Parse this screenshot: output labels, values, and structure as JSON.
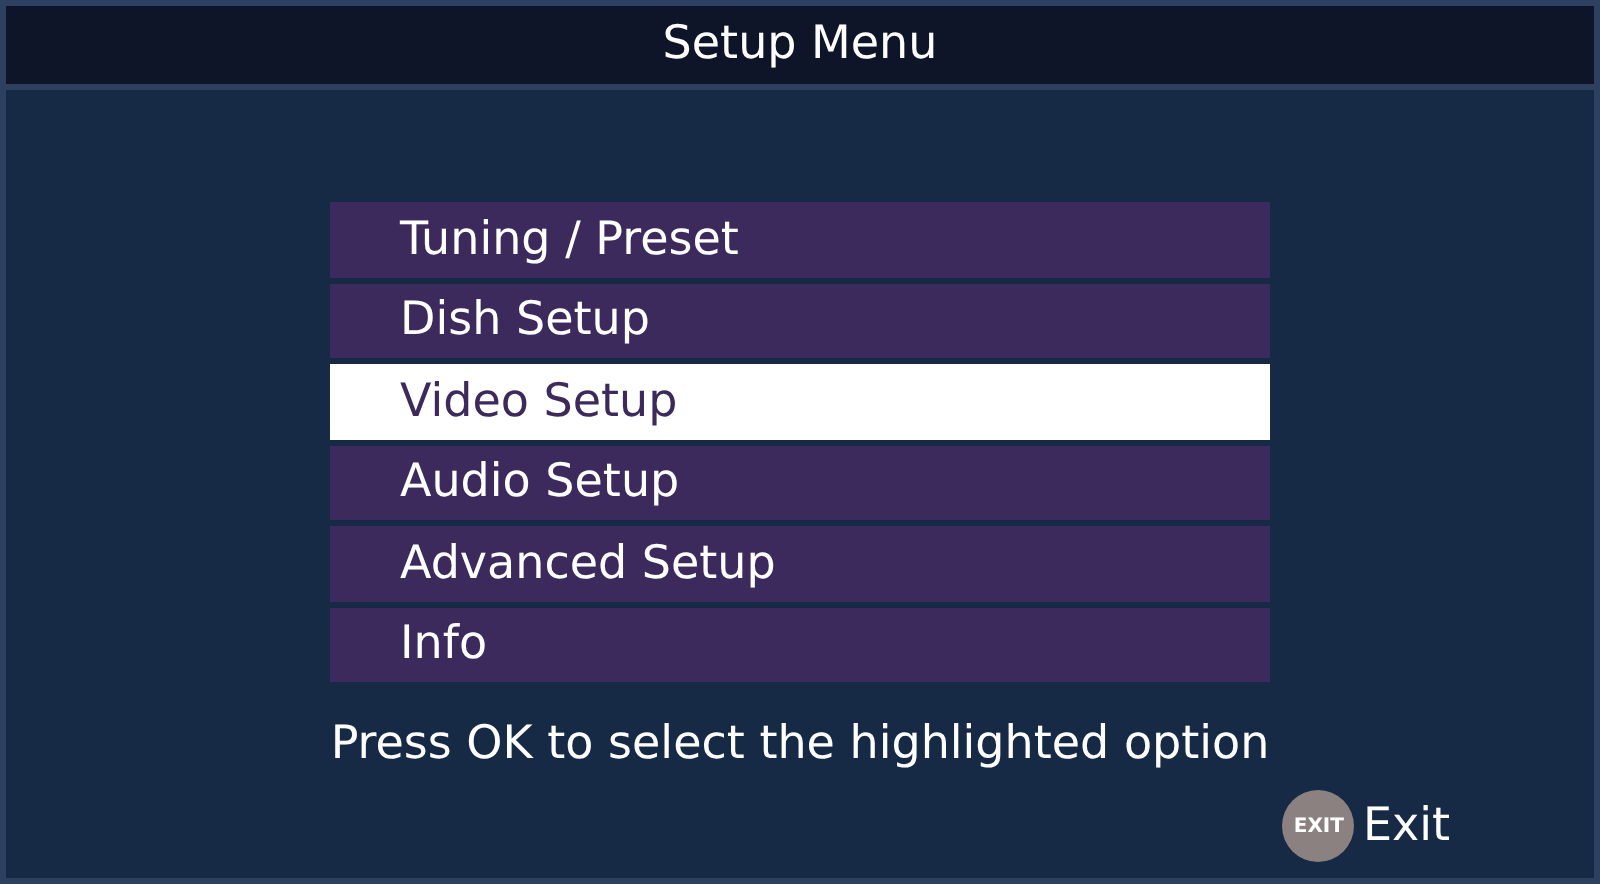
{
  "window": {
    "title": "Setup Menu"
  },
  "menu": [
    {
      "label": "Tuning / Preset",
      "selected": false
    },
    {
      "label": "Dish Setup",
      "selected": false
    },
    {
      "label": "Video Setup",
      "selected": true
    },
    {
      "label": "Audio Setup",
      "selected": false
    },
    {
      "label": "Advanced Setup",
      "selected": false
    },
    {
      "label": "Info",
      "selected": false
    }
  ],
  "hint": "Press OK to select the highlighted option",
  "exit": {
    "key": "EXIT",
    "label": "Exit"
  }
}
